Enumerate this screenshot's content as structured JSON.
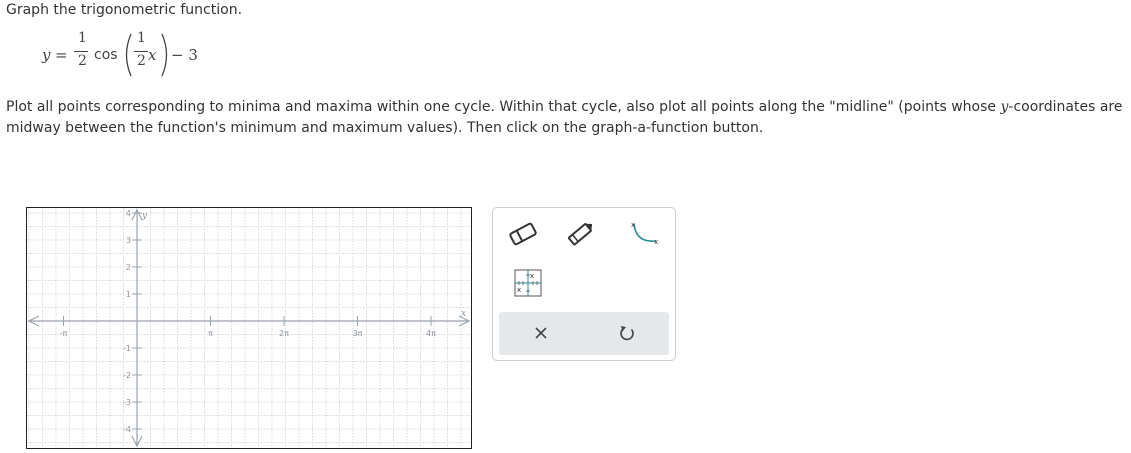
{
  "instruction": "Graph the trigonometric function.",
  "equation": {
    "lhs": "y",
    "equals": "=",
    "coef_num": "1",
    "coef_den": "2",
    "func": "cos",
    "arg_num": "1",
    "arg_den": "2",
    "arg_var": "x",
    "const": "− 3"
  },
  "plot_text": {
    "part1": "Plot all points corresponding to minima and maxima within one cycle. Within that cycle, also plot all points along the \"midline\" (points whose ",
    "var": "y",
    "part2": "-coordinates are midway between the function's minimum and maximum values). Then click on the graph-a-function button."
  },
  "graph": {
    "x_axis_label": "x",
    "y_axis_label": "y",
    "x_ticks": [
      {
        "value": -1,
        "label": "-π"
      },
      {
        "value": 1,
        "label": "π"
      },
      {
        "value": 2,
        "label": "2π"
      },
      {
        "value": 3,
        "label": "3π"
      },
      {
        "value": 4,
        "label": "4π"
      }
    ],
    "y_ticks": [
      {
        "value": 4,
        "label": "4"
      },
      {
        "value": 3,
        "label": "3"
      },
      {
        "value": 2,
        "label": "2"
      },
      {
        "value": 1,
        "label": "1"
      },
      {
        "value": -1,
        "label": "-1"
      },
      {
        "value": -2,
        "label": "-2"
      },
      {
        "value": -3,
        "label": "-3"
      },
      {
        "value": -4,
        "label": "-4"
      }
    ],
    "colors": {
      "axis": "#9aa4ac",
      "grid": "#d5dadf",
      "label": "#8c959d"
    }
  },
  "toolbar": {
    "tools": [
      "eraser-icon",
      "pencil-icon",
      "curve-icon",
      "graph-function-icon"
    ],
    "actions": [
      "clear-icon",
      "undo-icon"
    ],
    "accent": "#2a8a94"
  }
}
